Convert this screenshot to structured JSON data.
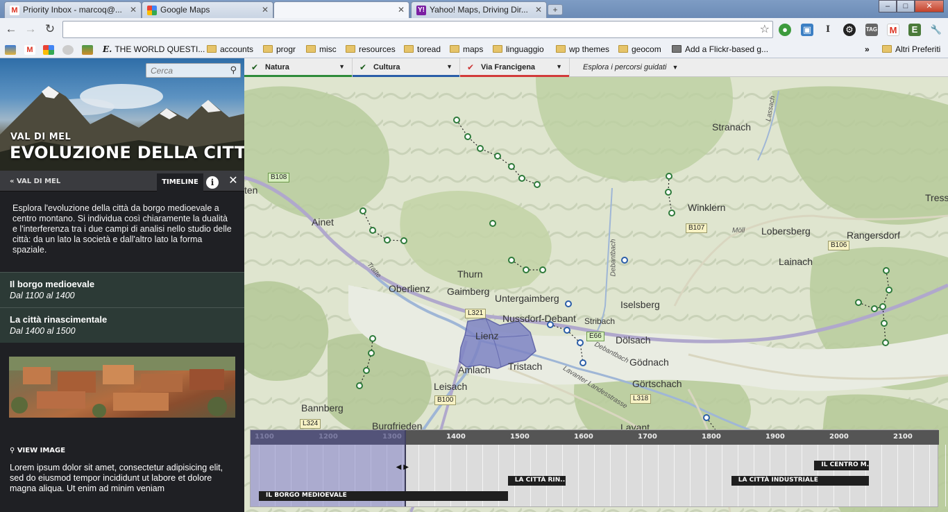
{
  "browser": {
    "tabs": [
      {
        "label": "Priority Inbox - marcoq@..."
      },
      {
        "label": "Google Maps"
      },
      {
        "label": ""
      },
      {
        "label": "Yahoo! Maps, Driving Dir..."
      }
    ],
    "new_tab_label": "+",
    "window_controls": {
      "minimize": "–",
      "maximize": "□",
      "close": "✕"
    },
    "address": "",
    "bookmarks": [
      {
        "label": "THE WORLD QUESTI...",
        "type": "site"
      },
      {
        "label": "accounts",
        "type": "folder"
      },
      {
        "label": "progr",
        "type": "folder"
      },
      {
        "label": "misc",
        "type": "folder"
      },
      {
        "label": "resources",
        "type": "folder"
      },
      {
        "label": "toread",
        "type": "folder"
      },
      {
        "label": "maps",
        "type": "folder"
      },
      {
        "label": "linguaggio",
        "type": "folder"
      },
      {
        "label": "wp themes",
        "type": "folder"
      },
      {
        "label": "geocom",
        "type": "folder"
      },
      {
        "label": "Add a Flickr-based g...",
        "type": "site"
      }
    ],
    "bookmarks_overflow": "»",
    "other_bookmarks": "Altri Preferiti"
  },
  "sidebar": {
    "search_placeholder": "Cerca",
    "subtitle": "VAL DI MEL",
    "title": "EVOLUZIONE DELLA CITTÀ",
    "back_label": "« VAL DI MEL",
    "tab_timeline": "TIMELINE",
    "info_label": "i",
    "close_label": "✕",
    "intro": "Esplora l'evoluzione della città da borgo medioevale a centro montano. Si individua così chiaramente la dualità e l'interferenza tra i due campi di analisi nello studio delle città: da un lato la società e dall'altro lato la forma spaziale.",
    "periods": [
      {
        "title": "Il borgo medioevale",
        "dates": "Dal 1100 al 1400"
      },
      {
        "title": "La città rinascimentale",
        "dates": "Dal 1400 al 1500"
      }
    ],
    "view_image": "VIEW IMAGE",
    "lorem": "Lorem ipsum dolor sit amet, consectetur adipisicing elit, sed do eiusmod tempor incididunt ut labore et dolore magna aliqua. Ut enim ad minim veniam"
  },
  "filters": [
    {
      "label": "Natura",
      "checked": true,
      "color": "#2e8b3a"
    },
    {
      "label": "Cultura",
      "checked": true,
      "color": "#2a5da8"
    },
    {
      "label": "Via Francigena",
      "checked": true,
      "color": "#d23a3a"
    }
  ],
  "guided_tours": "Esplora i percorsi guidati",
  "map": {
    "places": [
      "Stranach",
      "Winklern",
      "Lobersberg",
      "Rangersdorf",
      "Tress",
      "Lainach",
      "Ainet",
      "Thurn",
      "Oberlienz",
      "Gaimberg",
      "Untergaimberg",
      "Iselsberg",
      "Nussdorf-Debant",
      "Stribach",
      "Dölsach",
      "Lienz",
      "Amlach",
      "Tristach",
      "Gödnach",
      "Görtschach",
      "Leisach",
      "Bannberg",
      "Burgfrieden",
      "Lavant",
      "ten"
    ],
    "roads": [
      "B108",
      "B107",
      "B106",
      "L321",
      "E66",
      "B100",
      "L318",
      "L324"
    ],
    "small_labels": [
      "Tratte",
      "Debantbach",
      "Möll",
      "Lassach",
      "Debantbach",
      "Lavanter Landesstrasse"
    ]
  },
  "timeline": {
    "years": [
      "1100",
      "1200",
      "1300",
      "1400",
      "1500",
      "1600",
      "1700",
      "1800",
      "1900",
      "2000",
      "2100"
    ],
    "window": [
      1100,
      1330
    ],
    "events": [
      {
        "label": "IL BORGO MEDIOEVALE",
        "start": 1100,
        "end": 1490
      },
      {
        "label": "LA CITTÀ RIN...",
        "start": 1490,
        "end": 1580
      },
      {
        "label": "LA CITTÀ INDUSTRIALE",
        "start": 1840,
        "end": 2055
      },
      {
        "label": "IL CENTRO M...",
        "start": 1970,
        "end": 2055
      }
    ]
  }
}
